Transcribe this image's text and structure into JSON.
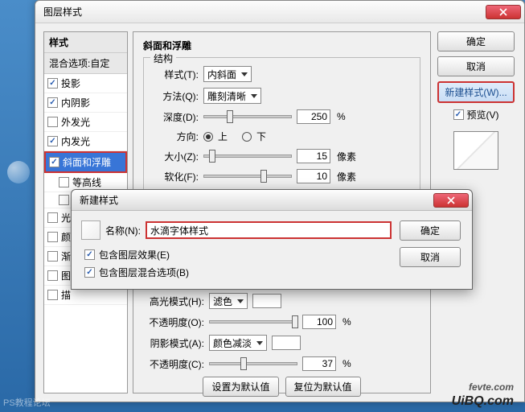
{
  "main_dialog": {
    "title": "图层样式",
    "left": {
      "header": "样式",
      "blend": "混合选项:自定",
      "items": [
        {
          "label": "投影",
          "checked": true
        },
        {
          "label": "内阴影",
          "checked": true
        },
        {
          "label": "外发光",
          "checked": false
        },
        {
          "label": "内发光",
          "checked": true
        },
        {
          "label": "斜面和浮雕",
          "checked": true,
          "selected": true
        },
        {
          "label": "等高线",
          "checked": false,
          "sub": true
        },
        {
          "label": "",
          "checked": false,
          "sub": true
        },
        {
          "label": "光",
          "checked": false
        },
        {
          "label": "颜",
          "checked": false
        },
        {
          "label": "渐",
          "checked": false
        },
        {
          "label": "图",
          "checked": false
        },
        {
          "label": "描",
          "checked": false
        }
      ]
    },
    "middle": {
      "section": "斜面和浮雕",
      "struct_legend": "结构",
      "style_label": "样式(T):",
      "style_value": "内斜面",
      "method_label": "方法(Q):",
      "method_value": "雕刻清晰",
      "depth_label": "深度(D):",
      "depth_value": "250",
      "percent": "%",
      "direction_label": "方向:",
      "up": "上",
      "down": "下",
      "size_label": "大小(Z):",
      "size_value": "15",
      "px": "像素",
      "soften_label": "软化(F):",
      "soften_value": "10",
      "highlight_mode_label": "高光模式(H):",
      "highlight_mode_value": "滤色",
      "opacity1_label": "不透明度(O):",
      "opacity1_value": "100",
      "shadow_mode_label": "阴影模式(A):",
      "shadow_mode_value": "颜色减淡",
      "opacity2_label": "不透明度(C):",
      "opacity2_value": "37",
      "btn_default": "设置为默认值",
      "btn_reset": "复位为默认值"
    },
    "right": {
      "ok": "确定",
      "cancel": "取消",
      "new_style": "新建样式(W)...",
      "preview": "预览(V)"
    }
  },
  "inner_dialog": {
    "title": "新建样式",
    "name_label": "名称(N):",
    "name_value": "水滴字体样式",
    "include_effects": "包含图层效果(E)",
    "include_blend": "包含图层混合选项(B)",
    "ok": "确定",
    "cancel": "取消"
  },
  "watermark": {
    "l1": "fevte.com",
    "l2": "UiBQ.com"
  },
  "ps_wm": "PS教程论坛"
}
